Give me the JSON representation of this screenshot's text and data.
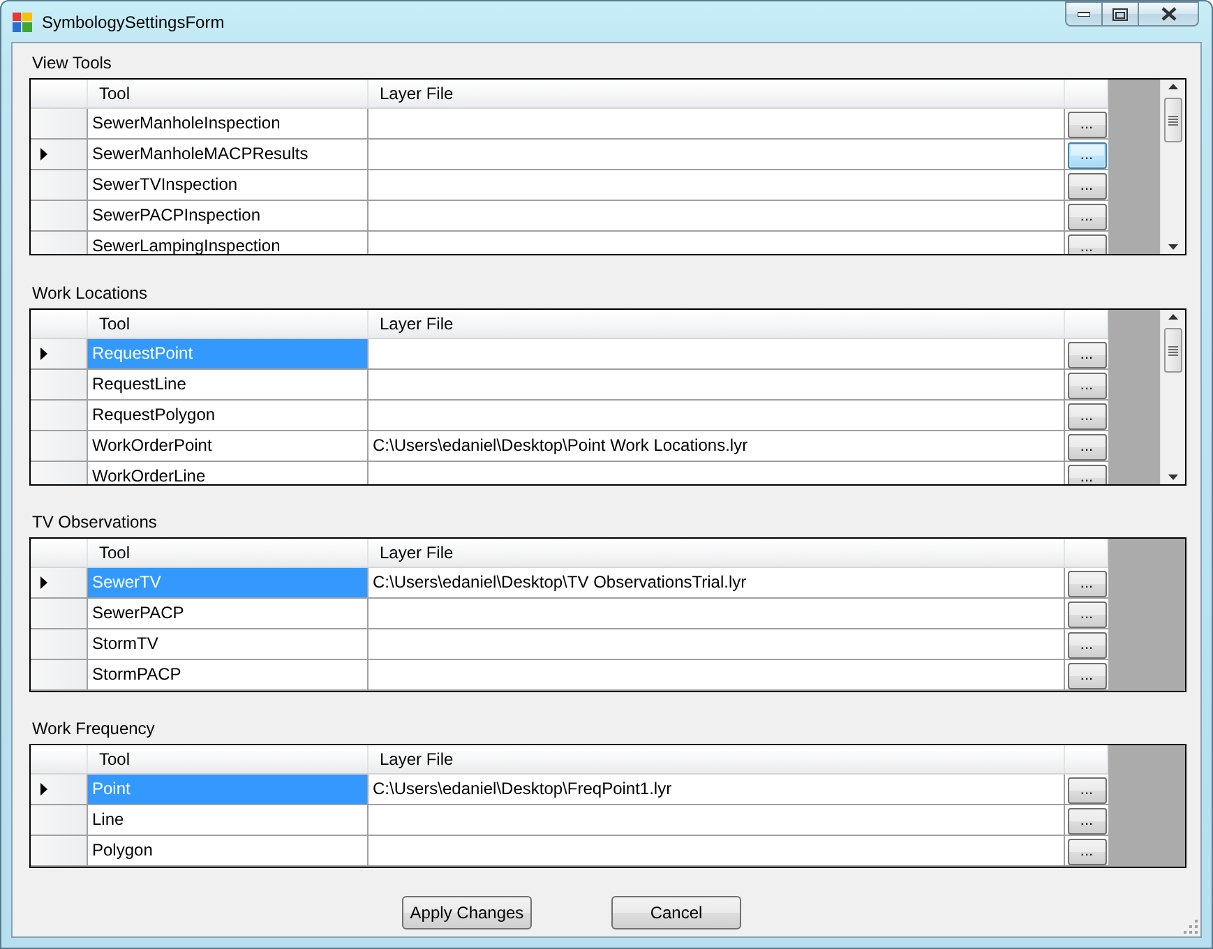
{
  "window": {
    "title": "SymbologySettingsForm"
  },
  "sections": [
    {
      "label": "View Tools",
      "columns": [
        "Tool",
        "Layer File"
      ],
      "scrollbar": true,
      "rows": [
        {
          "tool": "SewerManholeInspection",
          "button": "...",
          "current": false,
          "selected": false,
          "button_focused": false
        },
        {
          "tool": "SewerManholeMACPResults",
          "button": "...",
          "current": true,
          "selected": false,
          "button_focused": true
        },
        {
          "tool": "SewerTVInspection",
          "button": "...",
          "current": false,
          "selected": false,
          "button_focused": false
        },
        {
          "tool": "SewerPACPInspection",
          "button": "...",
          "current": false,
          "selected": false,
          "button_focused": false
        },
        {
          "tool": "SewerLampingInspection",
          "button": "...",
          "current": false,
          "selected": false,
          "button_focused": false
        }
      ]
    },
    {
      "label": "Work Locations",
      "columns": [
        "Tool",
        "Layer File"
      ],
      "scrollbar": true,
      "rows": [
        {
          "tool": "RequestPoint",
          "button": "...",
          "current": true,
          "selected": true,
          "button_focused": false
        },
        {
          "tool": "RequestLine",
          "button": "...",
          "current": false,
          "selected": false,
          "button_focused": false
        },
        {
          "tool": "RequestPolygon",
          "button": "...",
          "current": false,
          "selected": false,
          "button_focused": false
        },
        {
          "tool": "WorkOrderPoint",
          "layer_file": "C:\\Users\\edaniel\\Desktop\\Point Work Locations.lyr",
          "button": "...",
          "current": false,
          "selected": false,
          "button_focused": false
        },
        {
          "tool": "WorkOrderLine",
          "button": "...",
          "current": false,
          "selected": false,
          "button_focused": false
        }
      ]
    },
    {
      "label": "TV Observations",
      "columns": [
        "Tool",
        "Layer File"
      ],
      "scrollbar": false,
      "rows": [
        {
          "tool": "SewerTV",
          "layer_file": "C:\\Users\\edaniel\\Desktop\\TV ObservationsTrial.lyr",
          "button": "...",
          "current": true,
          "selected": true,
          "button_focused": false
        },
        {
          "tool": "SewerPACP",
          "button": "...",
          "current": false,
          "selected": false,
          "button_focused": false
        },
        {
          "tool": "StormTV",
          "button": "...",
          "current": false,
          "selected": false,
          "button_focused": false
        },
        {
          "tool": "StormPACP",
          "button": "...",
          "current": false,
          "selected": false,
          "button_focused": false
        }
      ]
    },
    {
      "label": "Work Frequency",
      "columns": [
        "Tool",
        "Layer File"
      ],
      "scrollbar": false,
      "rows": [
        {
          "tool": "Point",
          "layer_file": "C:\\Users\\edaniel\\Desktop\\FreqPoint1.lyr",
          "button": "...",
          "current": true,
          "selected": true,
          "button_focused": false
        },
        {
          "tool": "Line",
          "button": "...",
          "current": false,
          "selected": false,
          "button_focused": false
        },
        {
          "tool": "Polygon",
          "button": "...",
          "current": false,
          "selected": false,
          "button_focused": false
        }
      ]
    }
  ],
  "buttons": [
    "Apply Changes",
    "Cancel"
  ]
}
